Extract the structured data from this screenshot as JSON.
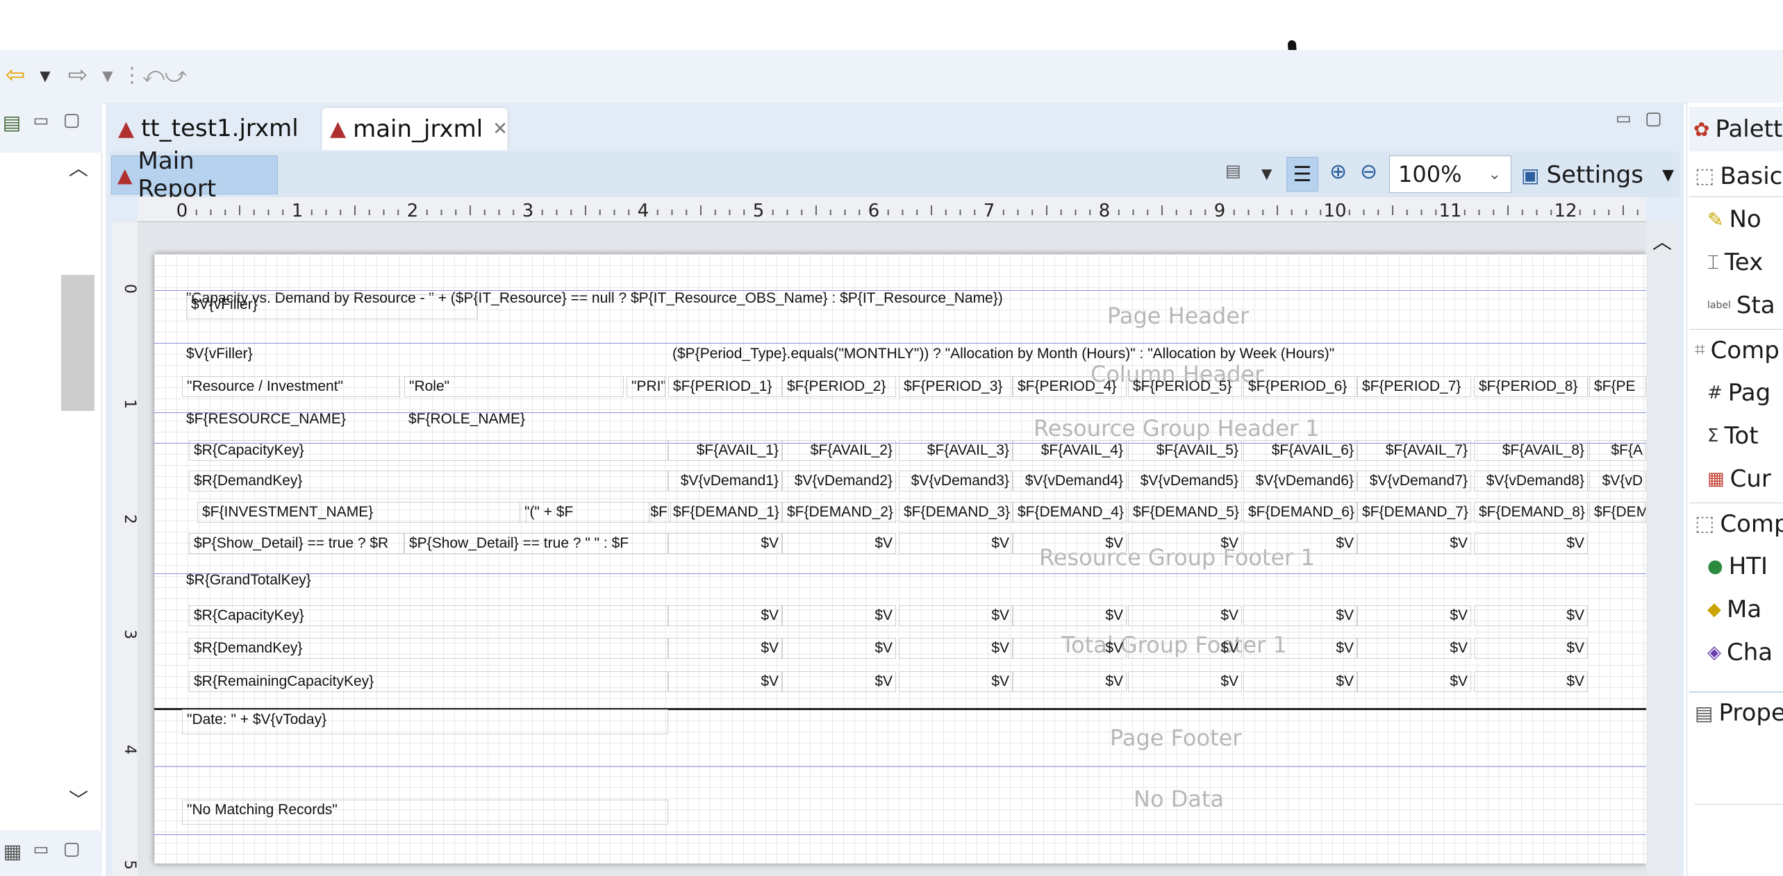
{
  "editor_tabs": [
    {
      "label": "tt_test1.jrxml"
    },
    {
      "label": "main_jrxml"
    }
  ],
  "report_selector": "Main Report",
  "zoom": "100%",
  "settings_label": "Settings",
  "ruler_marks": [
    "0",
    "1",
    "2",
    "3",
    "4",
    "5",
    "6",
    "7",
    "8",
    "9",
    "10",
    "11",
    "12"
  ],
  "vruler_marks": [
    "0",
    "1",
    "2",
    "3",
    "4",
    "5"
  ],
  "bands": {
    "page_header": "Page Header",
    "column_header": "Column Header",
    "resource_group_header": "Resource Group Header 1",
    "resource_group_footer": "Resource Group Footer 1",
    "total_group_footer": "Total Group Footer 1",
    "page_footer": "Page Footer",
    "no_data": "No Data"
  },
  "fields": {
    "title": "\"Capacity vs. Demand by Resource - \" + ($P{IT_Resource} == null ? $P{IT_Resource_OBS_Name} : $P{IT_Resource_Name})",
    "filler1": "$V{vFiller}",
    "filler2": "$V{vFiller}",
    "period_type": "($P{Period_Type}.equals(\"MONTHLY\")) ? \"Allocation by Month (Hours)\" : \"Allocation by Week (Hours)\"",
    "hdr_resource": "\"Resource / Investment\"",
    "hdr_role": "\"Role\"",
    "hdr_pri": "\"PRI\"",
    "periods": [
      "$F{PERIOD_1}",
      "$F{PERIOD_2}",
      "$F{PERIOD_3}",
      "$F{PERIOD_4}",
      "$F{PERIOD_5}",
      "$F{PERIOD_6}",
      "$F{PERIOD_7}",
      "$F{PERIOD_8}",
      "$F{PE"
    ],
    "resource_name": "$F{RESOURCE_NAME}",
    "role_name": "$F{ROLE_NAME}",
    "capacity_key": "$R{CapacityKey}",
    "avails": [
      "$F{AVAIL_1}",
      "$F{AVAIL_2}",
      "$F{AVAIL_3}",
      "$F{AVAIL_4}",
      "$F{AVAIL_5}",
      "$F{AVAIL_6}",
      "$F{AVAIL_7}",
      "$F{AVAIL_8}",
      "$F{A"
    ],
    "demand_key": "$R{DemandKey}",
    "vdemands": [
      "$V{vDemand1}",
      "$V{vDemand2}",
      "$V{vDemand3}",
      "$V{vDemand4}",
      "$V{vDemand5}",
      "$V{vDemand6}",
      "$V{vDemand7}",
      "$V{vDemand8}",
      "$V{vD"
    ],
    "investment_name": "$F{INVESTMENT_NAME}",
    "inv_paren": "\"(\" + $F",
    "inv_sf": "$F",
    "demands": [
      "$F{DEMAND_1}",
      "$F{DEMAND_2}",
      "$F{DEMAND_3}",
      "$F{DEMAND_4}",
      "$F{DEMAND_5}",
      "$F{DEMAND_6}",
      "$F{DEMAND_7}",
      "$F{DEMAND_8}",
      "$F{DEM"
    ],
    "show_detail_1": "$P{Show_Detail} == true ? $R",
    "show_detail_2": "$P{Show_Detail} == true ? \" \" : $F",
    "v_short": "$V",
    "grand_total_key": "$R{GrandTotalKey}",
    "total_capacity_key": "$R{CapacityKey}",
    "total_demand_key": "$R{DemandKey}",
    "remaining_key": "$R{RemainingCapacityKey}",
    "date": "\"Date:  \" + $V{vToday}",
    "no_records": "\"No Matching Records\""
  },
  "palette": {
    "title": "Palett",
    "sections": [
      {
        "label": "Basic",
        "items": [
          "No",
          "Tex",
          "Sta"
        ]
      },
      {
        "label": "Comp",
        "items": [
          "Pag",
          "Tot",
          "Cur"
        ]
      },
      {
        "label": "Comp",
        "items": [
          "HTI",
          "Ma",
          "Cha"
        ]
      }
    ],
    "properties": "Prope",
    "static_icon_label": "label"
  },
  "colors": {
    "band_line": "#8a8fe0",
    "band_label": "#b7b7b7",
    "selected_tab": "#b7d2ee"
  }
}
